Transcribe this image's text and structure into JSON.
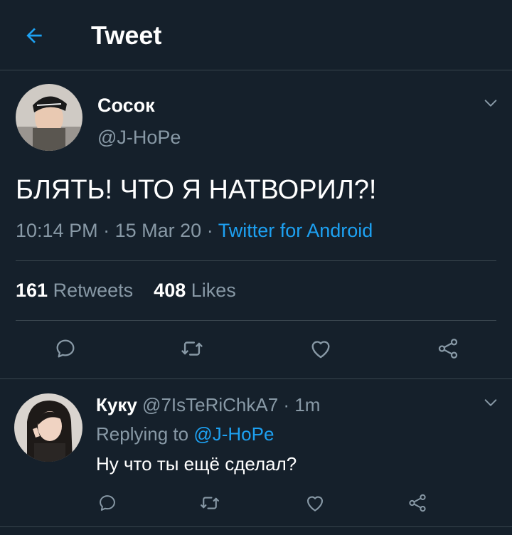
{
  "header": {
    "title": "Tweet"
  },
  "colors": {
    "background": "#15202b",
    "accent": "#1da1f2",
    "muted": "#8899a6",
    "divider": "#38444d"
  },
  "tweet": {
    "display_name": "Сосок",
    "handle": "@J-HoPe",
    "text": "БЛЯТЬ! ЧТО Я НАТВОРИЛ?!",
    "time": "10:14 PM",
    "date": "15 Mar 20",
    "source": "Twitter for Android",
    "retweets_count": "161",
    "retweets_label": "Retweets",
    "likes_count": "408",
    "likes_label": "Likes",
    "actions": [
      "comment-icon",
      "retweet-icon",
      "heart-icon",
      "share-icon"
    ]
  },
  "reply": {
    "display_name": "Куку",
    "handle": "@7IsTeRiChkA7",
    "time": "1m",
    "replying_label": "Replying to",
    "replying_to": "@J-HoPe",
    "text": "Ну что ты ещё сделал?",
    "actions": [
      "comment-icon",
      "retweet-icon",
      "heart-icon",
      "share-icon"
    ]
  }
}
